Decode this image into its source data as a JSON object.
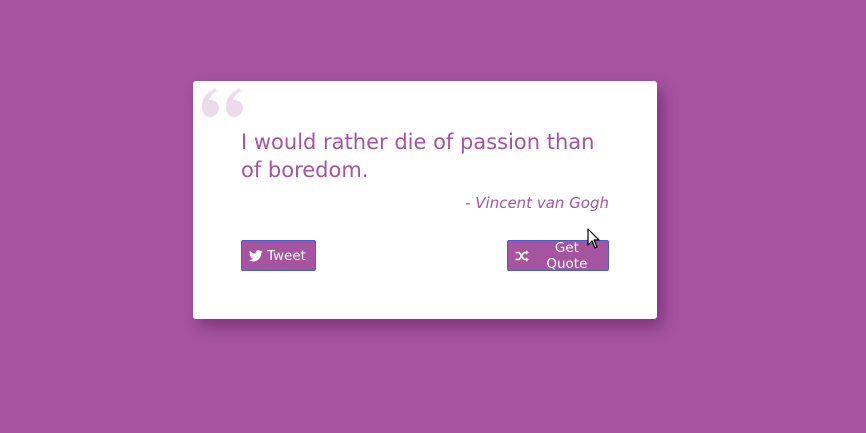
{
  "quote": {
    "text": "I would rather die of passion than of boredom.",
    "author": "- Vincent van Gogh"
  },
  "buttons": {
    "tweet_label": "Tweet",
    "get_quote_label": "Get Quote"
  },
  "icons": {
    "quote_mark": "quote-left-icon",
    "tweet": "twitter-icon",
    "get_quote": "shuffle-icon",
    "cursor": "mouse-pointer-icon"
  },
  "colors": {
    "background": "#A653A0",
    "card": "#FFFFFF",
    "accent": "#A653A0",
    "quote_mark": "#ECDCEB",
    "button_border": "#3F5FD8"
  }
}
